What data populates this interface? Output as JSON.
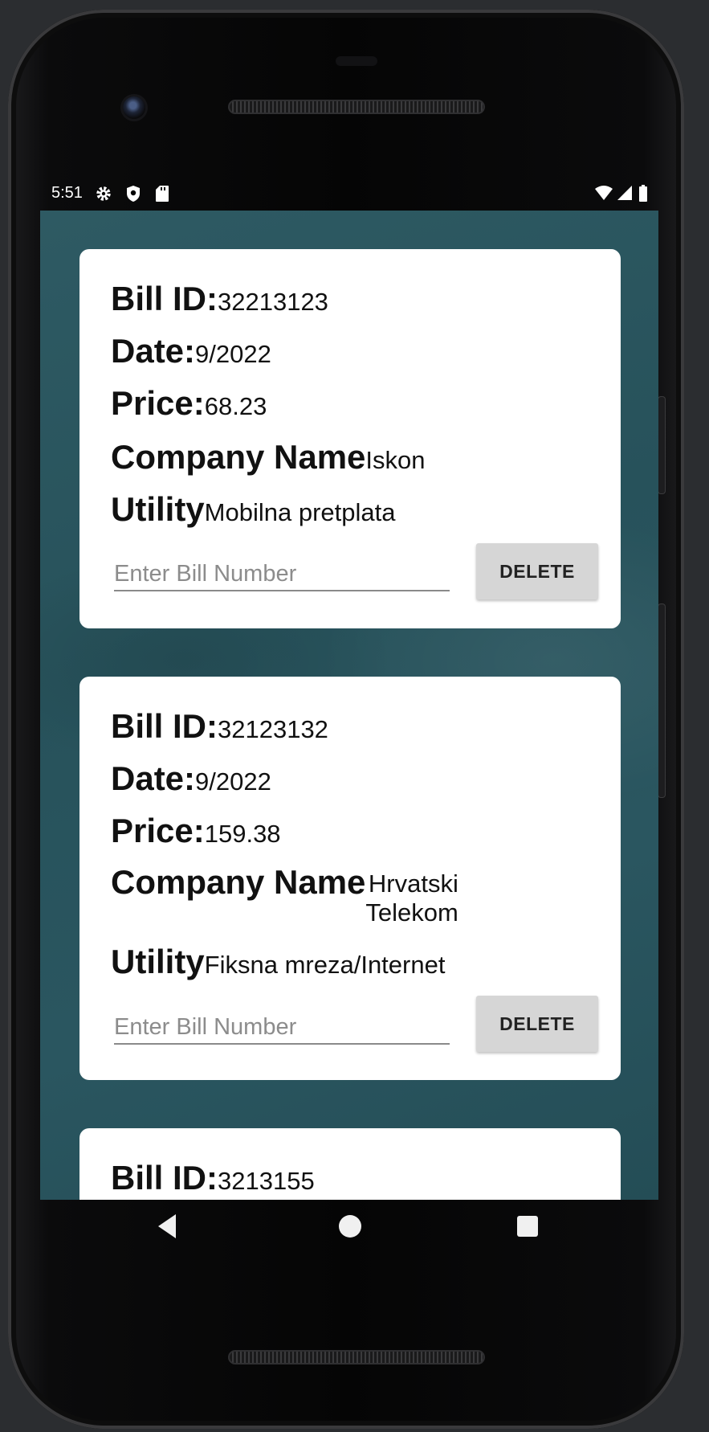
{
  "status_bar": {
    "time": "5:51",
    "icons": [
      "gear-icon",
      "shield-icon",
      "sd-card-icon",
      "wifi-icon",
      "cell-signal-icon",
      "battery-icon"
    ]
  },
  "bills": [
    {
      "bill_id_label": "Bill ID:",
      "bill_id": "32213123",
      "date_label": "Date:",
      "date": "9/2022",
      "price_label": "Price:",
      "price": "68.23",
      "company_label": "Company Name",
      "company_line1": "Iskon",
      "company_line2": "",
      "utility_label": "Utility",
      "utility": "Mobilna pretplata",
      "input_placeholder": "Enter Bill Number",
      "delete_label": "DELETE"
    },
    {
      "bill_id_label": "Bill ID:",
      "bill_id": "32123132",
      "date_label": "Date:",
      "date": "9/2022",
      "price_label": "Price:",
      "price": "159.38",
      "company_label": "Company Name",
      "company_line1": "Hrvatski",
      "company_line2": "Telekom",
      "utility_label": "Utility",
      "utility": "Fiksna mreza/Internet",
      "input_placeholder": "Enter Bill Number",
      "delete_label": "DELETE"
    },
    {
      "bill_id_label": "Bill ID:",
      "bill_id": "3213155"
    }
  ],
  "colors": {
    "screen_background": "#2b5760",
    "card_background": "#ffffff",
    "delete_button": "#d6d6d6"
  },
  "nav_bar": {
    "icons": [
      "back-icon",
      "home-icon",
      "recents-icon"
    ]
  }
}
